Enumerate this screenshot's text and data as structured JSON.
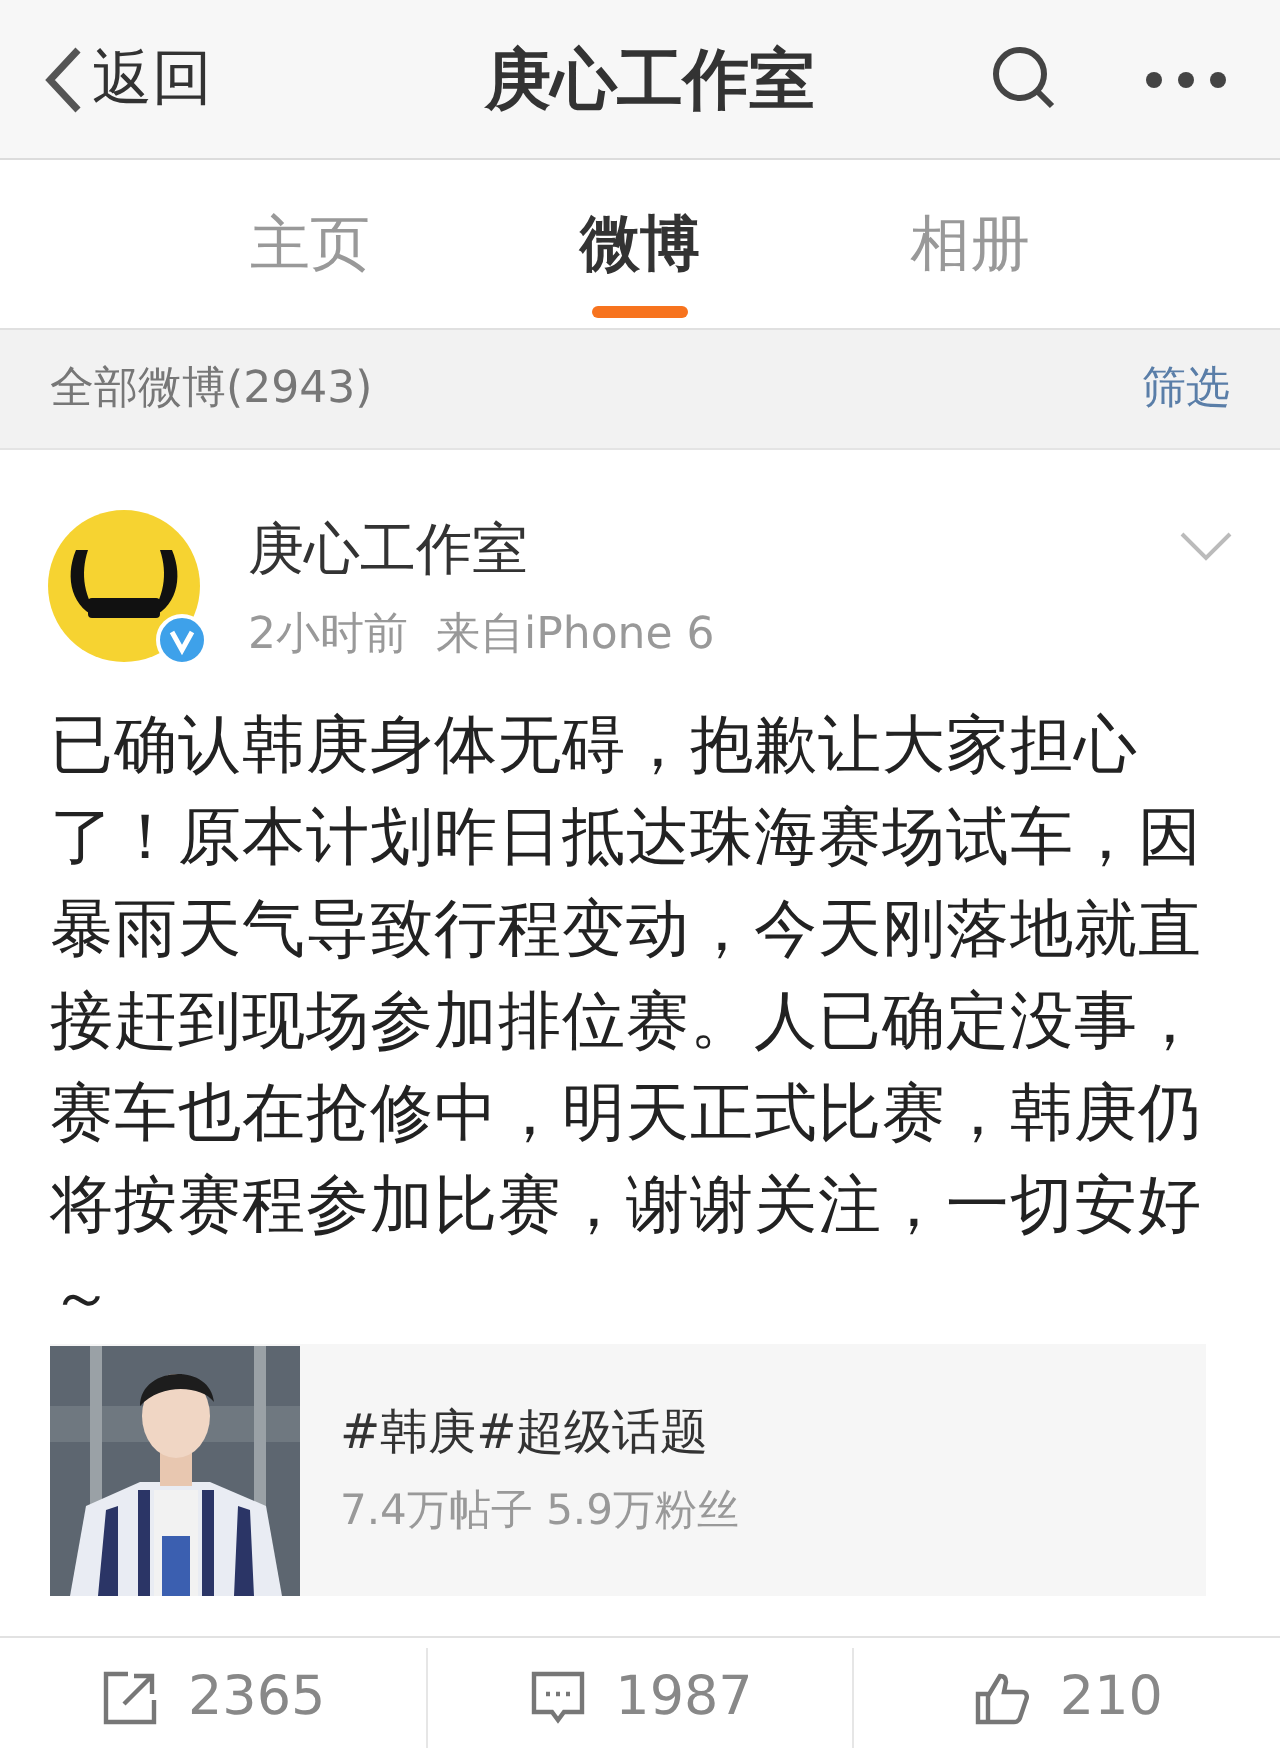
{
  "nav": {
    "back": "返回",
    "title": "庚心工作室"
  },
  "tabs": [
    {
      "label": "主页",
      "selected": false
    },
    {
      "label": "微博",
      "selected": true
    },
    {
      "label": "相册",
      "selected": false
    }
  ],
  "filter_bar": {
    "label": "全部微博(2943)",
    "action": "筛选"
  },
  "post": {
    "author": "庚心工作室",
    "verified": true,
    "time": "2小时前",
    "source": "来自iPhone 6",
    "text": "已确认韩庚身体无碍，抱歉让大家担心了！原本计划昨日抵达珠海赛场试车，因暴雨天气导致行程变动，今天刚落地就直接赶到现场参加排位赛。人已确定没事，赛车也在抢修中，明天正式比赛，韩庚仍将按赛程参加比赛，谢谢关注，一切安好～",
    "topic": {
      "title": "#韩庚#超级话题",
      "stats": "7.4万帖子 5.9万粉丝"
    }
  },
  "actions": [
    {
      "kind": "repost",
      "count": "2365"
    },
    {
      "kind": "comment",
      "count": "1987"
    },
    {
      "kind": "like",
      "count": "210"
    }
  ]
}
